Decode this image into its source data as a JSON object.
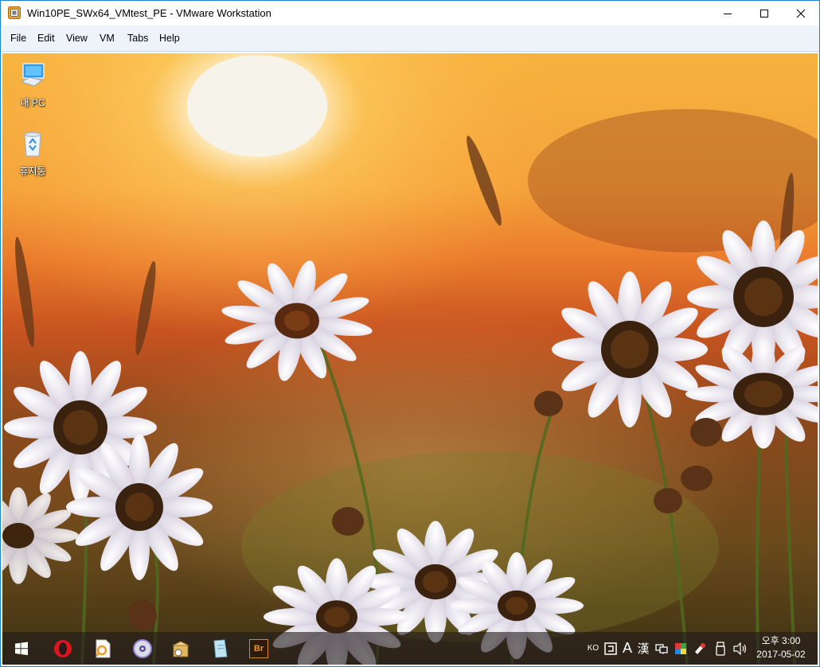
{
  "window": {
    "title": "Win10PE_SWx64_VMtest_PE - VMware Workstation",
    "controls": [
      "minimize",
      "maximize",
      "close"
    ],
    "accent_color": "#1883d7"
  },
  "menu": {
    "items": [
      "File",
      "Edit",
      "View",
      "VM",
      "Tabs",
      "Help"
    ]
  },
  "desktop": {
    "icons": [
      {
        "label": "내 PC",
        "icon": "computer-icon"
      },
      {
        "label": "휴지통",
        "icon": "recycle-bin-icon"
      }
    ]
  },
  "taskbar": {
    "apps": [
      "start-icon",
      "opera-icon",
      "image-viewer-icon",
      "dvd-burner-icon",
      "archive-icon",
      "notepad-icon",
      "bridge-icon"
    ],
    "bridge_label": "Br",
    "tray": {
      "lang": "KO",
      "ime_a": "A",
      "ime_han": "漢"
    },
    "clock": {
      "time": "오후 3:00",
      "date": "2017-05-02"
    }
  }
}
